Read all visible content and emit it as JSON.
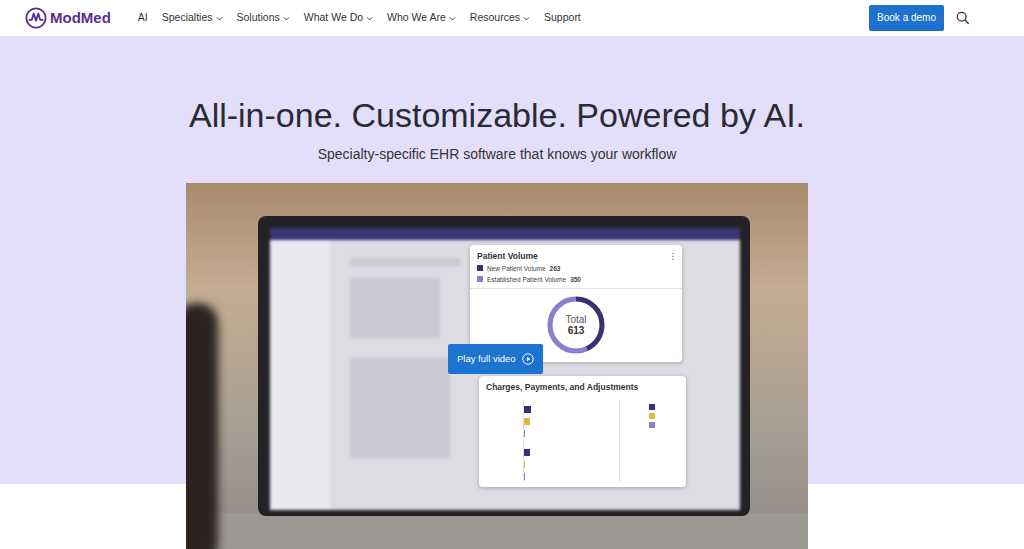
{
  "nav": {
    "logo": "ModMed",
    "items": [
      {
        "label": "AI",
        "has_menu": false
      },
      {
        "label": "Specialties",
        "has_menu": true
      },
      {
        "label": "Solutions",
        "has_menu": true
      },
      {
        "label": "What We Do",
        "has_menu": true
      },
      {
        "label": "Who We Are",
        "has_menu": true
      },
      {
        "label": "Resources",
        "has_menu": true
      },
      {
        "label": "Support",
        "has_menu": false
      }
    ],
    "cta": "Book a demo"
  },
  "hero": {
    "title": "All-in-one. Customizable. Powered by AI.",
    "subtitle": "Specialty-specific EHR software that knows your workflow"
  },
  "video": {
    "play_label": "Play full video",
    "patient_volume": {
      "title": "Patient Volume",
      "series": [
        {
          "label": "New Patient Volume",
          "value": "263",
          "amount": 263,
          "color": "#3d2f73"
        },
        {
          "label": "Established Patient Volume",
          "value": "350",
          "amount": 350,
          "color": "#8d7dd0"
        }
      ],
      "total_label": "Total",
      "total": "613"
    },
    "charges": {
      "title": "Charges, Payments, and Adjustments",
      "series": [
        {
          "color": "#3d2f73",
          "values": [
            6,
            5
          ]
        },
        {
          "color": "#e5b93c",
          "values": [
            5,
            0
          ]
        },
        {
          "color": "#8d7dd0",
          "values": [
            1,
            1
          ]
        }
      ]
    }
  }
}
